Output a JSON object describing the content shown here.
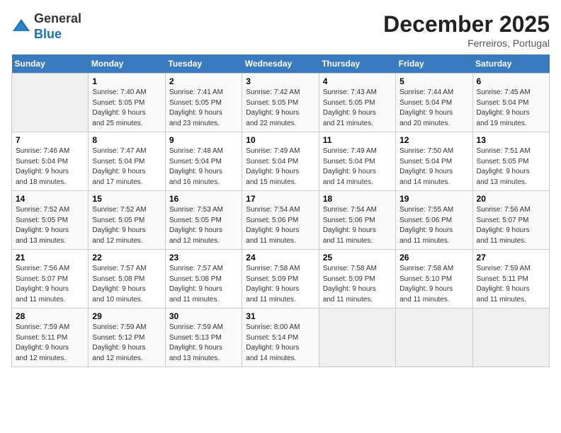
{
  "header": {
    "logo_line1": "General",
    "logo_line2": "Blue",
    "title": "December 2025",
    "subtitle": "Ferreiros, Portugal"
  },
  "weekdays": [
    "Sunday",
    "Monday",
    "Tuesday",
    "Wednesday",
    "Thursday",
    "Friday",
    "Saturday"
  ],
  "weeks": [
    [
      {
        "day": "",
        "info": ""
      },
      {
        "day": "1",
        "info": "Sunrise: 7:40 AM\nSunset: 5:05 PM\nDaylight: 9 hours\nand 25 minutes."
      },
      {
        "day": "2",
        "info": "Sunrise: 7:41 AM\nSunset: 5:05 PM\nDaylight: 9 hours\nand 23 minutes."
      },
      {
        "day": "3",
        "info": "Sunrise: 7:42 AM\nSunset: 5:05 PM\nDaylight: 9 hours\nand 22 minutes."
      },
      {
        "day": "4",
        "info": "Sunrise: 7:43 AM\nSunset: 5:05 PM\nDaylight: 9 hours\nand 21 minutes."
      },
      {
        "day": "5",
        "info": "Sunrise: 7:44 AM\nSunset: 5:04 PM\nDaylight: 9 hours\nand 20 minutes."
      },
      {
        "day": "6",
        "info": "Sunrise: 7:45 AM\nSunset: 5:04 PM\nDaylight: 9 hours\nand 19 minutes."
      }
    ],
    [
      {
        "day": "7",
        "info": "Sunrise: 7:46 AM\nSunset: 5:04 PM\nDaylight: 9 hours\nand 18 minutes."
      },
      {
        "day": "8",
        "info": "Sunrise: 7:47 AM\nSunset: 5:04 PM\nDaylight: 9 hours\nand 17 minutes."
      },
      {
        "day": "9",
        "info": "Sunrise: 7:48 AM\nSunset: 5:04 PM\nDaylight: 9 hours\nand 16 minutes."
      },
      {
        "day": "10",
        "info": "Sunrise: 7:49 AM\nSunset: 5:04 PM\nDaylight: 9 hours\nand 15 minutes."
      },
      {
        "day": "11",
        "info": "Sunrise: 7:49 AM\nSunset: 5:04 PM\nDaylight: 9 hours\nand 14 minutes."
      },
      {
        "day": "12",
        "info": "Sunrise: 7:50 AM\nSunset: 5:04 PM\nDaylight: 9 hours\nand 14 minutes."
      },
      {
        "day": "13",
        "info": "Sunrise: 7:51 AM\nSunset: 5:05 PM\nDaylight: 9 hours\nand 13 minutes."
      }
    ],
    [
      {
        "day": "14",
        "info": "Sunrise: 7:52 AM\nSunset: 5:05 PM\nDaylight: 9 hours\nand 13 minutes."
      },
      {
        "day": "15",
        "info": "Sunrise: 7:52 AM\nSunset: 5:05 PM\nDaylight: 9 hours\nand 12 minutes."
      },
      {
        "day": "16",
        "info": "Sunrise: 7:53 AM\nSunset: 5:05 PM\nDaylight: 9 hours\nand 12 minutes."
      },
      {
        "day": "17",
        "info": "Sunrise: 7:54 AM\nSunset: 5:06 PM\nDaylight: 9 hours\nand 11 minutes."
      },
      {
        "day": "18",
        "info": "Sunrise: 7:54 AM\nSunset: 5:06 PM\nDaylight: 9 hours\nand 11 minutes."
      },
      {
        "day": "19",
        "info": "Sunrise: 7:55 AM\nSunset: 5:06 PM\nDaylight: 9 hours\nand 11 minutes."
      },
      {
        "day": "20",
        "info": "Sunrise: 7:56 AM\nSunset: 5:07 PM\nDaylight: 9 hours\nand 11 minutes."
      }
    ],
    [
      {
        "day": "21",
        "info": "Sunrise: 7:56 AM\nSunset: 5:07 PM\nDaylight: 9 hours\nand 11 minutes."
      },
      {
        "day": "22",
        "info": "Sunrise: 7:57 AM\nSunset: 5:08 PM\nDaylight: 9 hours\nand 10 minutes."
      },
      {
        "day": "23",
        "info": "Sunrise: 7:57 AM\nSunset: 5:08 PM\nDaylight: 9 hours\nand 11 minutes."
      },
      {
        "day": "24",
        "info": "Sunrise: 7:58 AM\nSunset: 5:09 PM\nDaylight: 9 hours\nand 11 minutes."
      },
      {
        "day": "25",
        "info": "Sunrise: 7:58 AM\nSunset: 5:09 PM\nDaylight: 9 hours\nand 11 minutes."
      },
      {
        "day": "26",
        "info": "Sunrise: 7:58 AM\nSunset: 5:10 PM\nDaylight: 9 hours\nand 11 minutes."
      },
      {
        "day": "27",
        "info": "Sunrise: 7:59 AM\nSunset: 5:11 PM\nDaylight: 9 hours\nand 11 minutes."
      }
    ],
    [
      {
        "day": "28",
        "info": "Sunrise: 7:59 AM\nSunset: 5:11 PM\nDaylight: 9 hours\nand 12 minutes."
      },
      {
        "day": "29",
        "info": "Sunrise: 7:59 AM\nSunset: 5:12 PM\nDaylight: 9 hours\nand 12 minutes."
      },
      {
        "day": "30",
        "info": "Sunrise: 7:59 AM\nSunset: 5:13 PM\nDaylight: 9 hours\nand 13 minutes."
      },
      {
        "day": "31",
        "info": "Sunrise: 8:00 AM\nSunset: 5:14 PM\nDaylight: 9 hours\nand 14 minutes."
      },
      {
        "day": "",
        "info": ""
      },
      {
        "day": "",
        "info": ""
      },
      {
        "day": "",
        "info": ""
      }
    ]
  ]
}
